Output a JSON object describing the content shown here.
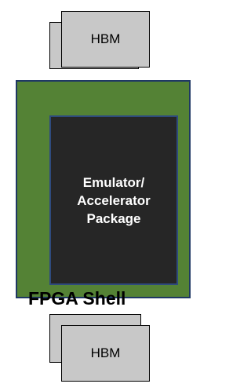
{
  "diagram": {
    "top_memory": {
      "label": "HBM",
      "fill_color": "#c8c8c8"
    },
    "bottom_memory": {
      "label": "HBM",
      "fill_color": "#c8c8c8"
    },
    "fpga_shell": {
      "label": "FPGA Shell",
      "fill_color": "#548235",
      "border_color": "#1f3864"
    },
    "package": {
      "label": "Emulator/\nAccelerator\nPackage",
      "fill_color": "#262626",
      "text_color": "#ffffff"
    }
  }
}
